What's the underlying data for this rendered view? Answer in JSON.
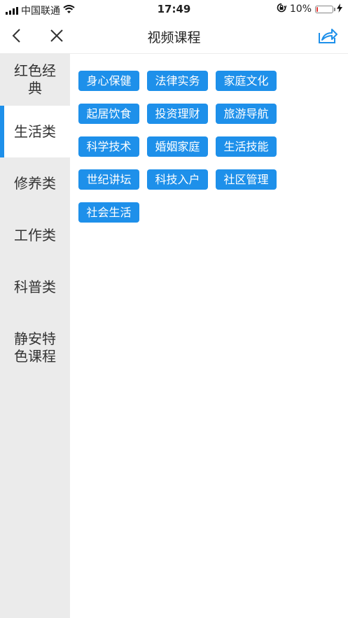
{
  "status_bar": {
    "carrier": "中国联通",
    "time": "17:49",
    "battery_percent_label": "10%",
    "battery_level": 0.1,
    "icons": [
      "signal-icon",
      "wifi-icon",
      "orientation-lock-icon",
      "battery-icon",
      "charging-icon"
    ]
  },
  "nav": {
    "title": "视频课程",
    "icons": [
      "back-icon",
      "close-icon",
      "share-icon"
    ]
  },
  "sidebar": {
    "items": [
      {
        "label": "红色经典",
        "active": false
      },
      {
        "label": "生活类",
        "active": true
      },
      {
        "label": "修养类",
        "active": false
      },
      {
        "label": "工作类",
        "active": false
      },
      {
        "label": "科普类",
        "active": false
      },
      {
        "label": "静安特色课程",
        "active": false
      }
    ]
  },
  "tags": [
    "身心保健",
    "法律实务",
    "家庭文化",
    "起居饮食",
    "投资理财",
    "旅游导航",
    "科学技术",
    "婚姻家庭",
    "生活技能",
    "世纪讲坛",
    "科技入户",
    "社区管理",
    "社会生活"
  ],
  "colors": {
    "accent": "#1e90ea",
    "sidebar_bg": "#ebebeb",
    "battery_low": "#e53935"
  }
}
